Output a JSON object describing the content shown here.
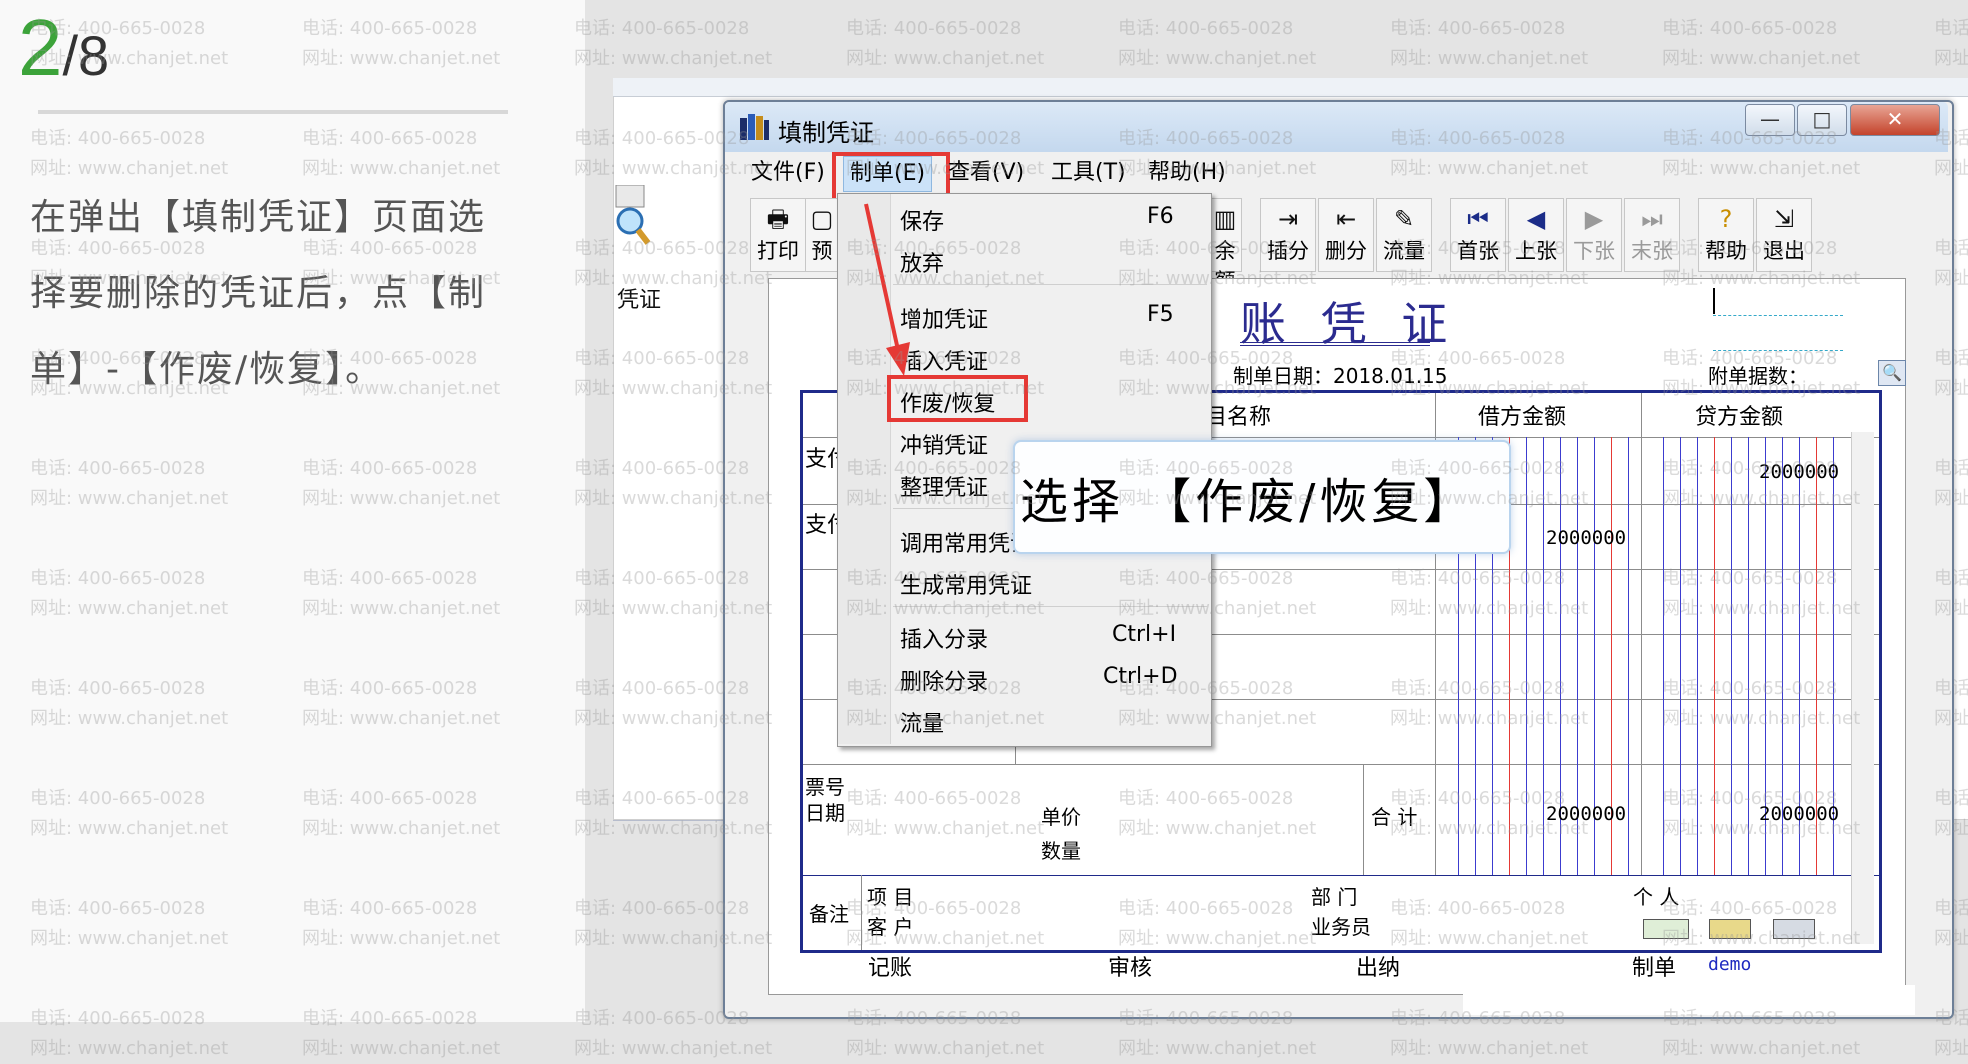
{
  "step": {
    "current": "2",
    "total": "/8"
  },
  "instruction": "在弹出【填制凭证】页面选择要删除的凭证后，点【制单】-【作废/恢复】。",
  "background_window": {
    "label": "凭证"
  },
  "dialog": {
    "title": "填制凭证",
    "controls": {
      "minimize": "—",
      "maximize": "□",
      "close": "✕"
    }
  },
  "menubar": [
    "文件(F)",
    "制单(E)",
    "查看(V)",
    "工具(T)",
    "帮助(H)"
  ],
  "toolbar": [
    {
      "label": "打印",
      "icon": "🖶"
    },
    {
      "label": "预",
      "icon": "▢"
    },
    {
      "label": "余额",
      "icon": "▥"
    },
    {
      "label": "插分",
      "icon": "⇥"
    },
    {
      "label": "删分",
      "icon": "⇤"
    },
    {
      "label": "流量",
      "icon": "✎"
    },
    {
      "label": "首张",
      "icon": "⏮"
    },
    {
      "label": "上张",
      "icon": "◀"
    },
    {
      "label": "下张",
      "icon": "▶"
    },
    {
      "label": "末张",
      "icon": "⏭"
    },
    {
      "label": "帮助",
      "icon": "?"
    },
    {
      "label": "退出",
      "icon": "⇲"
    }
  ],
  "dropdown": [
    {
      "label": "保存",
      "shortcut": "F6"
    },
    {
      "label": "放弃",
      "shortcut": ""
    },
    {
      "label": "增加凭证",
      "shortcut": "F5"
    },
    {
      "label": "插入凭证",
      "shortcut": ""
    },
    {
      "label": "作废/恢复",
      "shortcut": ""
    },
    {
      "label": "冲销凭证",
      "shortcut": ""
    },
    {
      "label": "整理凭证",
      "shortcut": ""
    },
    {
      "label": "调用常用凭证",
      "shortcut": ""
    },
    {
      "label": "生成常用凭证",
      "shortcut": ""
    },
    {
      "label": "插入分录",
      "shortcut": "Ctrl+I"
    },
    {
      "label": "删除分录",
      "shortcut": "Ctrl+D"
    },
    {
      "label": "流量",
      "shortcut": ""
    }
  ],
  "callout": "选择 【作废/恢复】",
  "voucher": {
    "title": "账 凭 证",
    "date_label": "制单日期：2018.01.15",
    "attach_label": "附单据数：",
    "col_account": "目名称",
    "col_debit": "借方金额",
    "col_credit": "贷方金额",
    "row1_summary": "支付",
    "row2_summary": "支付",
    "row1_credit": "2000000",
    "row2_debit": "2000000",
    "ticket_no": "票号",
    "date_field": "日期",
    "unit_price": "单价",
    "quantity": "数量",
    "total_label": "合 计",
    "total_debit": "2000000",
    "total_credit": "2000000",
    "remark": "备注",
    "project": "项  目",
    "customer": "客  户",
    "department": "部  门",
    "salesperson": "业务员",
    "personal": "个  人",
    "footer_bookkeep": "记账",
    "footer_audit": "审核",
    "footer_cashier": "出纳",
    "footer_maker": "制单",
    "maker_name": "demo"
  },
  "watermark": {
    "phone": "电话: 400-665-0028",
    "site": "网址: www.chanjet.net"
  },
  "colors": {
    "accent_green": "#3ca33a",
    "highlight_red": "#e53935",
    "voucher_blue": "#1f2a8a"
  }
}
